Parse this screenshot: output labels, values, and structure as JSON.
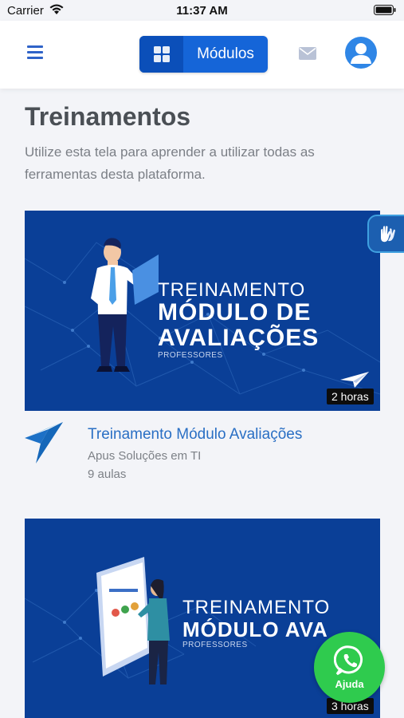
{
  "status_bar": {
    "carrier": "Carrier",
    "time": "11:37 AM"
  },
  "header": {
    "menu_icon": "hamburger-icon",
    "modules_label": "Módulos",
    "modules_icon": "grid-icon",
    "mail_icon": "envelope-icon",
    "avatar_icon": "user-icon",
    "accent": "#1565d8"
  },
  "page": {
    "title": "Treinamentos",
    "description": "Utilize esta tela para aprender a utilizar todas as ferramentas desta plataforma."
  },
  "accessibility": {
    "icon": "sign-language-hands-icon"
  },
  "courses": [
    {
      "banner": {
        "line1": "TREINAMENTO",
        "line2": "MÓDULO DE",
        "line3": "AVALIAÇÕES",
        "subtitle": "PROFESSORES"
      },
      "duration": "2 horas",
      "title": "Treinamento Módulo Avaliações",
      "author": "Apus Soluções em TI",
      "lessons": "9 aulas"
    },
    {
      "banner": {
        "line1": "TREINAMENTO",
        "line2": "MÓDULO AVA",
        "subtitle": "PROFESSORES"
      },
      "duration": "3 horas"
    }
  ],
  "help": {
    "label": "Ajuda",
    "icon": "whatsapp-icon",
    "color": "#2fcb4e"
  }
}
